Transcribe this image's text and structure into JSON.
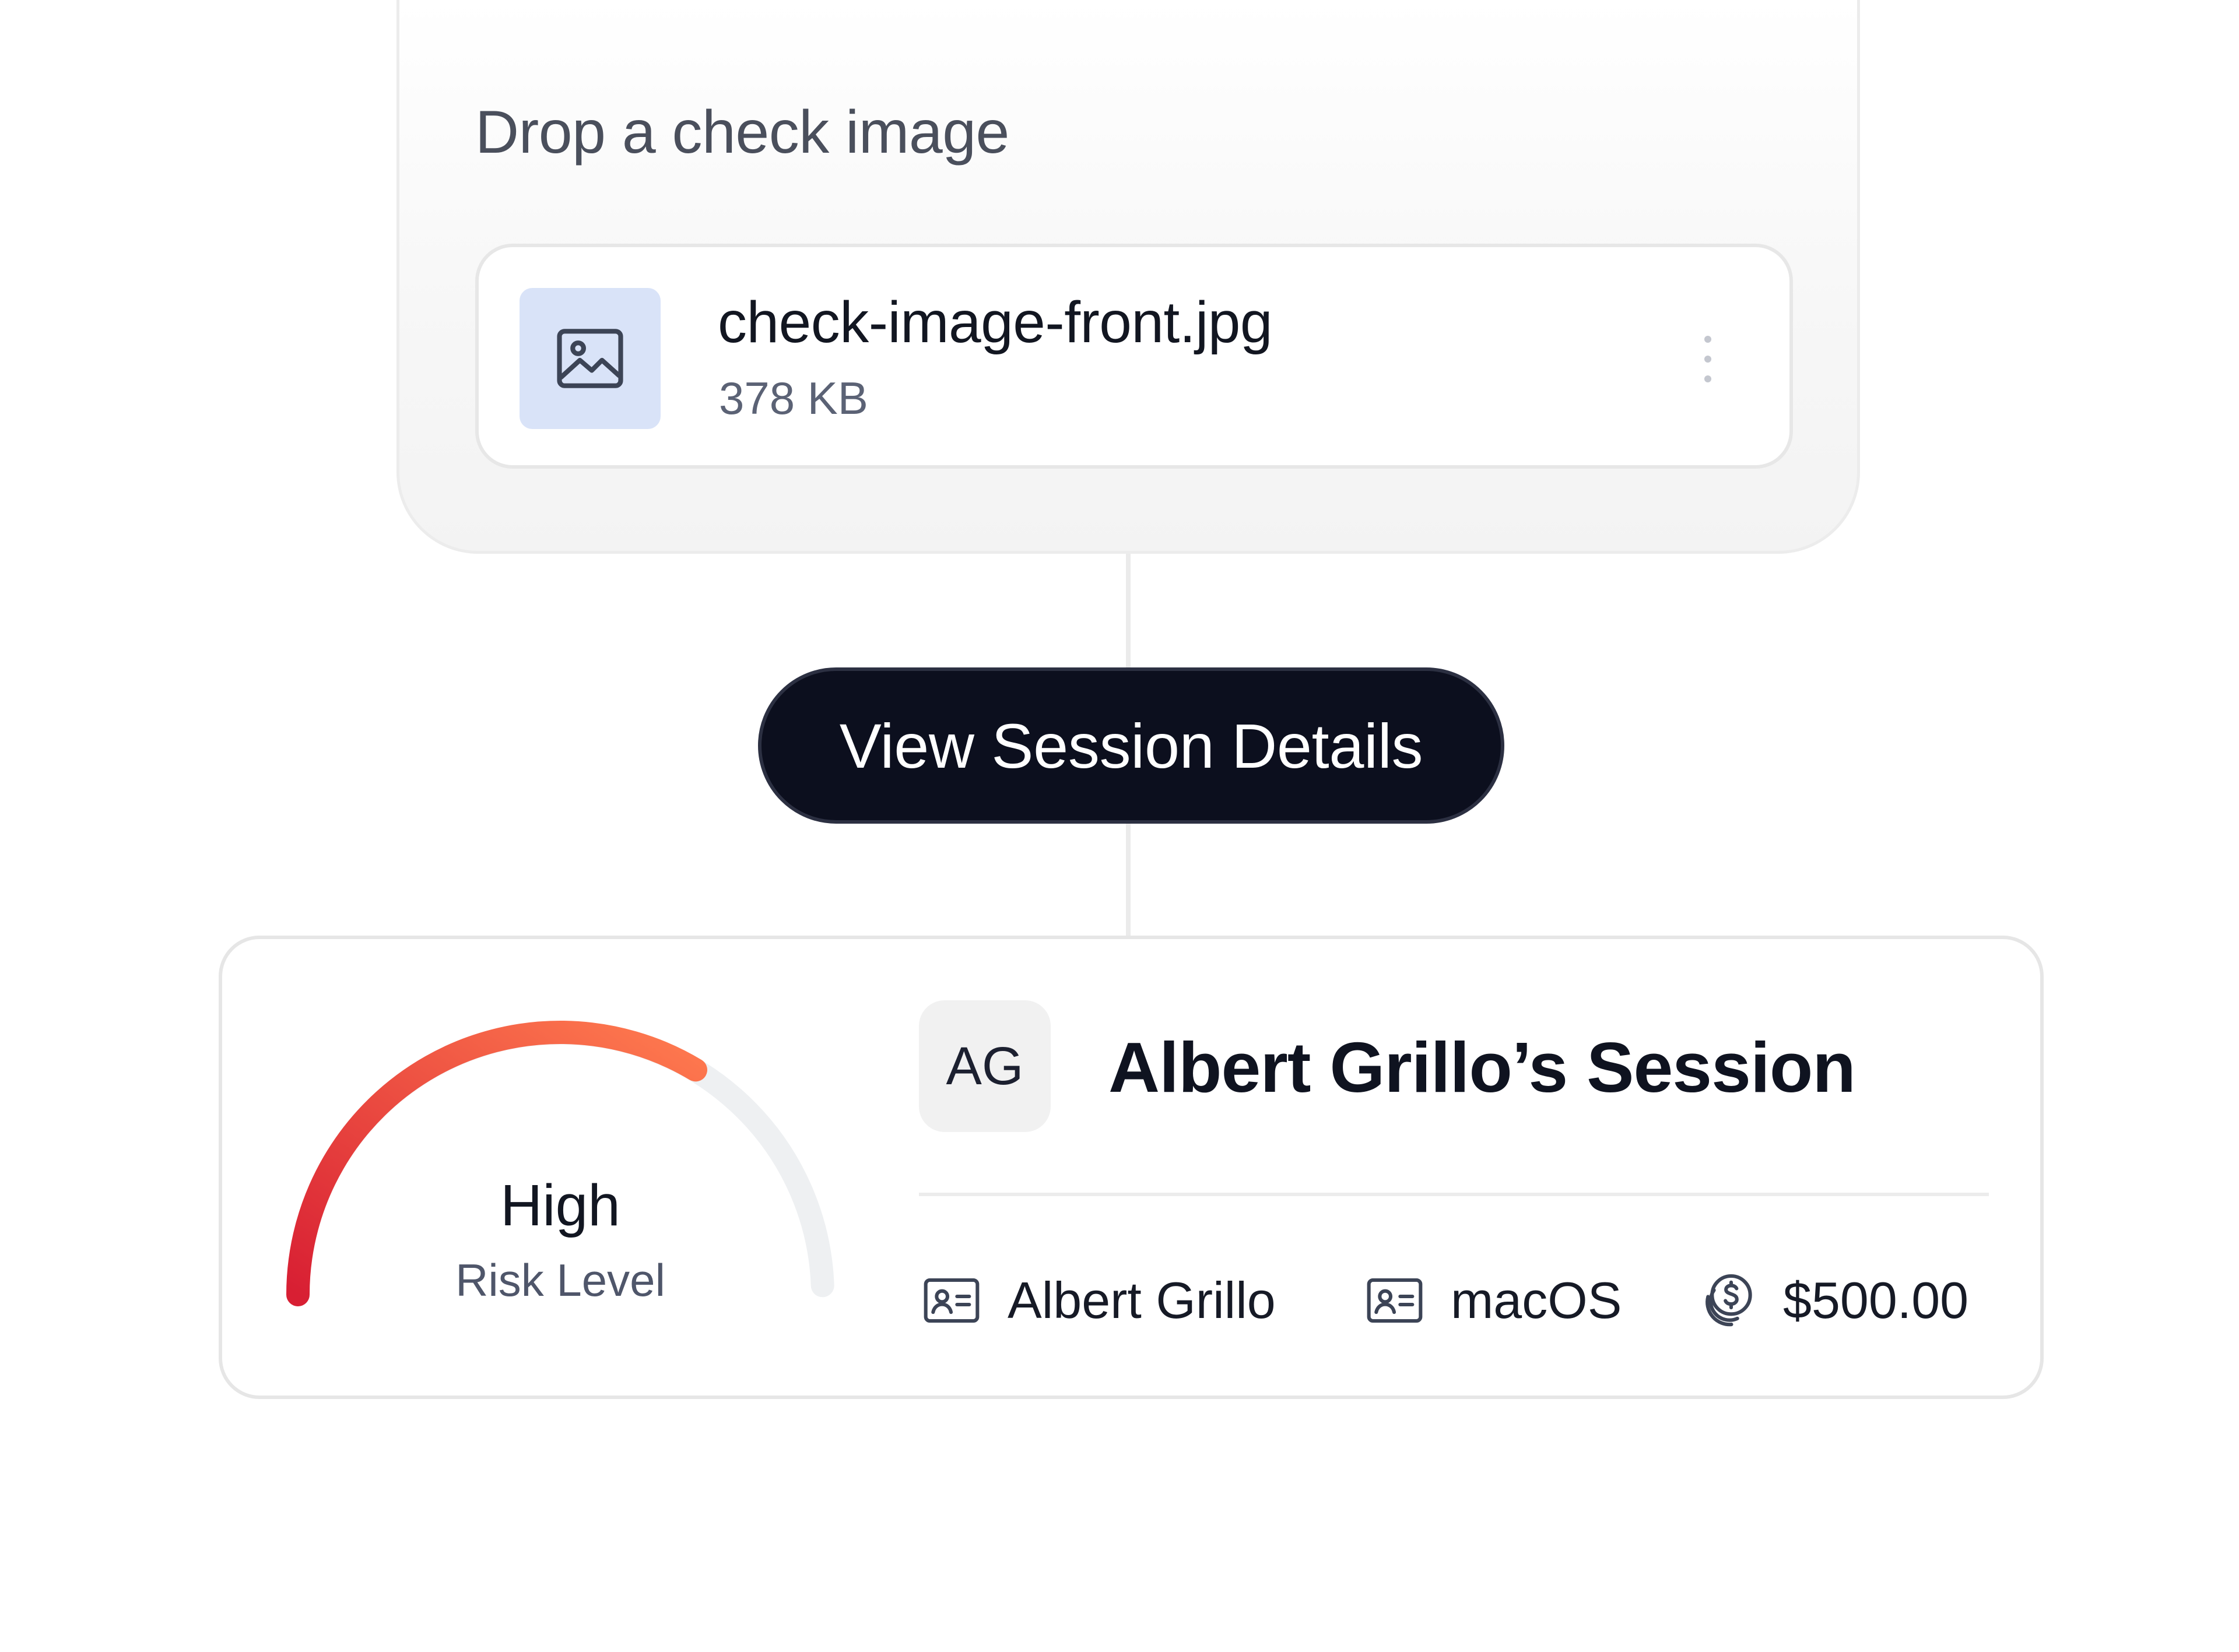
{
  "upload": {
    "title": "Drop a check image",
    "file": {
      "name": "check-image-front.jpg",
      "size": "378 KB",
      "icon": "image-icon",
      "thumb_color": "#d9e3f8"
    },
    "menu_icon": "more-vertical-icon"
  },
  "action": {
    "label": "View Session Details",
    "bg_color": "#0c0f1e"
  },
  "session": {
    "avatar_initials": "AG",
    "title": "Albert Grillo’s Session",
    "risk": {
      "level": "High",
      "caption": "Risk Level",
      "fill_fraction": 0.68,
      "gradient_start": "#d81f33",
      "gradient_end": "#ff7b4f",
      "track_color": "#eef0f2"
    },
    "meta": [
      {
        "icon": "id-card-icon",
        "text": "Albert Grillo"
      },
      {
        "icon": "id-card-icon",
        "text": "macOS"
      },
      {
        "icon": "coins-dollar-icon",
        "text": "$500.00"
      }
    ]
  }
}
